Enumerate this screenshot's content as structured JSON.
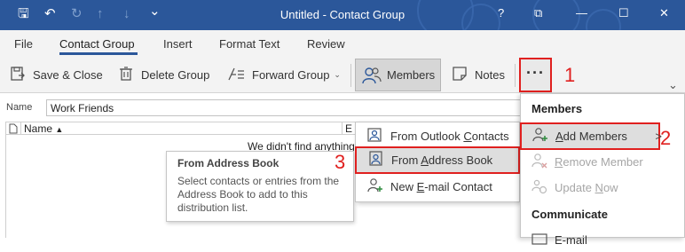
{
  "titlebar": {
    "title": "Untitled  -  Contact Group",
    "qat": {
      "save": "🖫",
      "undo": "↶",
      "redo": "↻",
      "up": "↑",
      "down": "↓",
      "customize": "⌄"
    },
    "window": {
      "help": "?",
      "ribbon_display": "⧉",
      "minimize": "—",
      "maximize": "☐",
      "close": "✕"
    }
  },
  "tabs": [
    "File",
    "Contact Group",
    "Insert",
    "Format Text",
    "Review"
  ],
  "toolbar": {
    "save_close": "Save & Close",
    "delete_group": "Delete Group",
    "forward_group": "Forward Group",
    "members": "Members",
    "notes": "Notes",
    "more": "···",
    "collapse": "⌄"
  },
  "annotations": {
    "one": "1",
    "two": "2",
    "three": "3"
  },
  "name_field": {
    "label": "Name",
    "value": "Work Friends"
  },
  "list": {
    "col_name": "Name",
    "col_email": "E",
    "empty_message": "We didn't find anything"
  },
  "tooltip": {
    "title": "From Address Book",
    "body": "Select contacts or entries from the Address Book to add to this distribution list."
  },
  "submenu": {
    "items": [
      "From Outlook Contacts",
      "From Address Book",
      "New E-mail Contact"
    ]
  },
  "overflow_menu": {
    "members_header": "Members",
    "add_members": "Add Members",
    "remove_member": "Remove Member",
    "update_now": "Update Now",
    "communicate_header": "Communicate",
    "email_partial": "E-mail"
  },
  "colors": {
    "title_bar": "#2b579a",
    "highlight_border": "#e0201f",
    "menu_hover": "#dedede"
  }
}
